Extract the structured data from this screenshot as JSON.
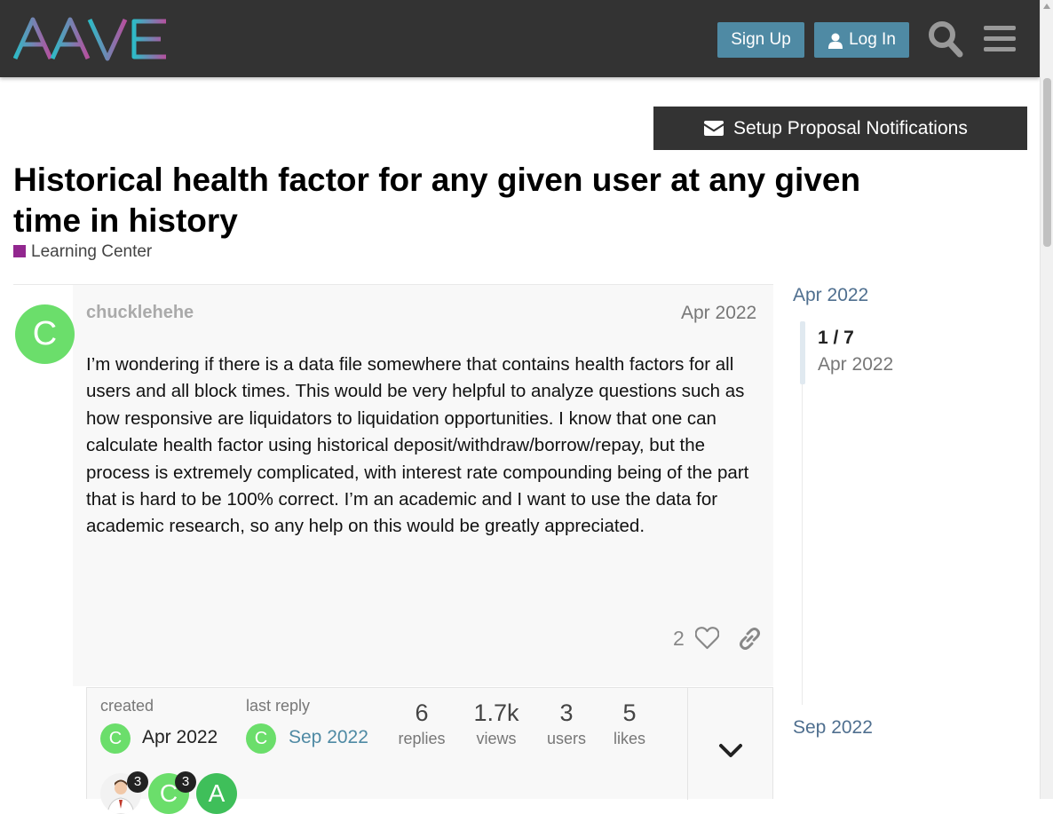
{
  "header": {
    "logo_text": "AAVE",
    "signup_label": "Sign Up",
    "login_label": "Log In",
    "icons": [
      "user-icon",
      "search-icon",
      "menu-icon"
    ]
  },
  "notifications": {
    "label": "Setup Proposal Notifications",
    "icon": "envelope-icon"
  },
  "topic": {
    "title": "Historical health factor for any given user at any given time in history",
    "category": "Learning Center",
    "category_color": "#92278f"
  },
  "post": {
    "avatar_letter": "C",
    "avatar_color": "#6bde6b",
    "username": "chucklehehe",
    "date": "Apr 2022",
    "body": "I’m wondering if there is a data file somewhere that contains health factors for all users and all block times. This would be very helpful to analyze questions such as how responsive are liquidators to liquidation opportunities. I know that one can calculate health factor using historical deposit/withdraw/borrow/repay, but the process is extremely complicated, with interest rate compounding being of the part that is hard to be 100% correct. I’m an academic and I want to use the data for academic research, so any help on this would be greatly appreciated.",
    "likes": "2"
  },
  "topic_map": {
    "created_label": "created",
    "created_date": "Apr 2022",
    "last_reply_label": "last reply",
    "last_reply_date": "Sep 2022",
    "stats": [
      {
        "value": "6",
        "label": "replies"
      },
      {
        "value": "1.7k",
        "label": "views"
      },
      {
        "value": "3",
        "label": "users"
      },
      {
        "value": "5",
        "label": "likes"
      }
    ],
    "participants": [
      {
        "letter": "",
        "count": "3",
        "color": "#f2f2f2"
      },
      {
        "letter": "C",
        "count": "3",
        "color": "#6bde6b"
      },
      {
        "letter": "A",
        "count": "",
        "color": "#3fbf5a"
      }
    ]
  },
  "timeline": {
    "start": "Apr 2022",
    "position": "1 / 7",
    "current_date": "Apr 2022",
    "end": "Sep 2022"
  }
}
